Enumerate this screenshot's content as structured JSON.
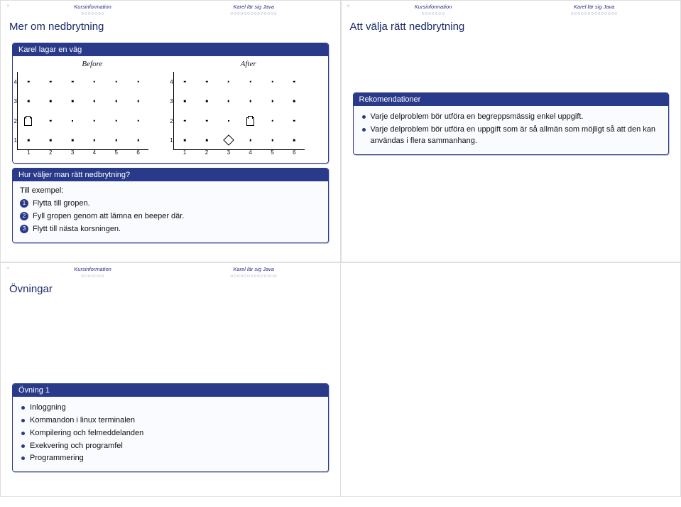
{
  "nav": {
    "col1": "Kursinformation",
    "col2": "Karel lär sig Java",
    "dots1": "○○○○○○○",
    "dots2": "○○○○○○○○○○○○○○"
  },
  "slide1": {
    "title": "Mer om nedbrytning",
    "block1_title": "Karel lagar en väg",
    "before_label": "Before",
    "after_label": "After",
    "block2_title": "Hur väljer man rätt nedbrytning?",
    "example_intro": "Till exempel:",
    "steps": [
      "Flytta till gropen.",
      "Fyll gropen genom att lämna en beeper där.",
      "Flytt till nästa korsningen."
    ],
    "grid": {
      "cols": [
        1,
        2,
        3,
        4,
        5,
        6
      ],
      "rows": [
        1,
        2,
        3,
        4
      ]
    }
  },
  "slide2": {
    "title": "Att välja rätt nedbrytning",
    "block_title": "Rekomendationer",
    "items": [
      "Varje delproblem bör utföra en begreppsmässig enkel uppgift.",
      "Varje delproblem bör utföra en uppgift som är så allmän som möjligt så att den kan användas i flera sammanhang."
    ]
  },
  "slide3": {
    "title": "Övningar",
    "block_title": "Övning 1",
    "items": [
      "Inloggning",
      "Kommandon i linux terminalen",
      "Kompilering och felmeddelanden",
      "Exekvering och programfel",
      "Programmering"
    ]
  }
}
